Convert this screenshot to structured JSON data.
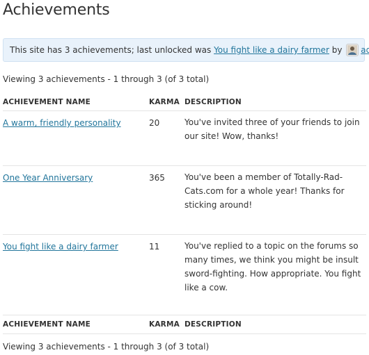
{
  "page": {
    "title": "Achievements"
  },
  "notice": {
    "prefix": "This site has 3 achievements; last unlocked was ",
    "last_achievement": "You fight like a dairy farmer",
    "by": " by ",
    "user": "admin"
  },
  "pagination": {
    "top": "Viewing 3 achievements - 1 through 3 (of 3 total)",
    "bottom": "Viewing 3 achievements - 1 through 3 (of 3 total)"
  },
  "table": {
    "headers": {
      "name": "Achievement Name",
      "karma": "Karma",
      "description": "Description"
    },
    "rows": [
      {
        "name": "A warm, friendly personality",
        "karma": "20",
        "description": "You've invited three of your friends to join our site! Wow, thanks!"
      },
      {
        "name": "One Year Anniversary",
        "karma": "365",
        "description": "You've been a member of Totally-Rad-Cats.com for a whole year! Thanks for sticking around!"
      },
      {
        "name": "You fight like a dairy farmer",
        "karma": "11",
        "description": "You've replied to a topic on the forums so many times, we think you might be insult sword-fighting. How appropriate. You fight like a cow."
      }
    ]
  },
  "colors": {
    "link": "#21759b",
    "notice_bg": "#e9f2fb",
    "notice_border": "#cfe1f2"
  }
}
